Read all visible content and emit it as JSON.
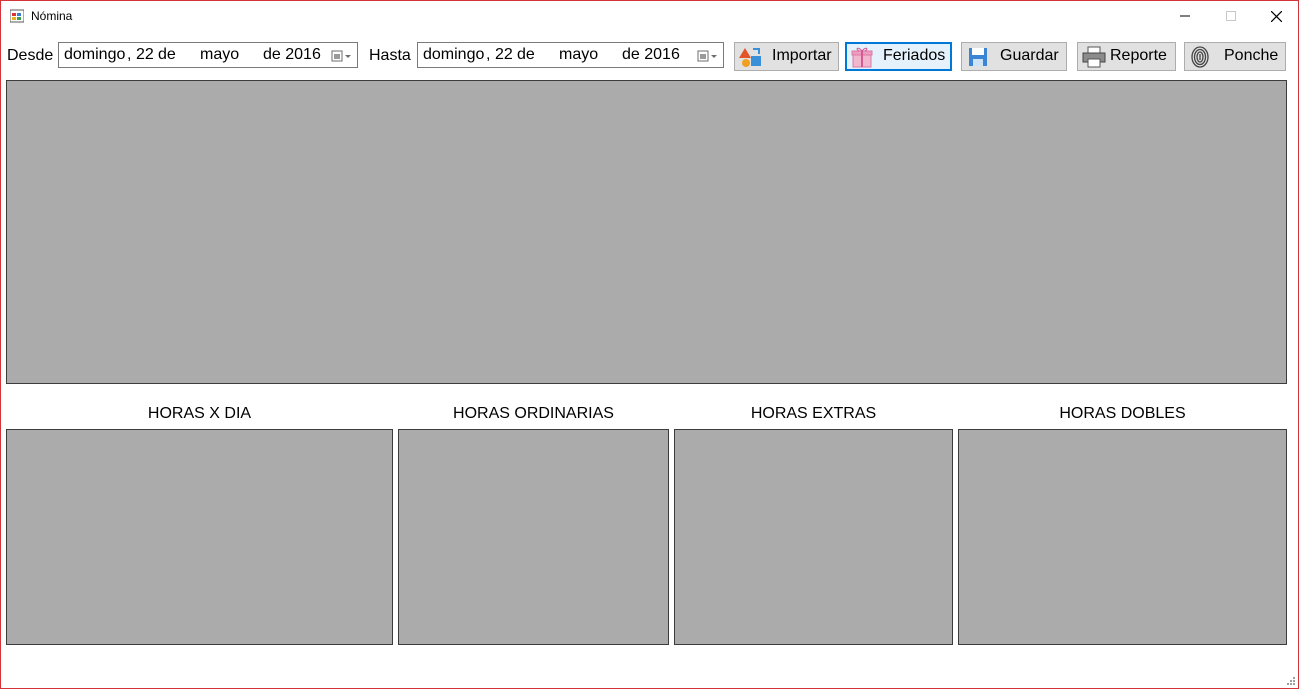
{
  "window": {
    "title": "Nómina"
  },
  "toolbar": {
    "desde_label": "Desde",
    "hasta_label": "Hasta",
    "desde_date": {
      "weekday": "domingo",
      "day": "22",
      "de1": "de",
      "month": "mayo",
      "year": "de 2016"
    },
    "hasta_date": {
      "weekday": "domingo",
      "day": "22",
      "de1": "de",
      "month": "mayo",
      "year": "de 2016"
    },
    "buttons": {
      "importar": "Importar",
      "feriados": "Feriados",
      "guardar": "Guardar",
      "reporte": "Reporte",
      "ponche": "Ponche"
    }
  },
  "panels": {
    "horas_x_dia": "HORAS X DIA",
    "horas_ordinarias": "HORAS ORDINARIAS",
    "horas_extras": "HORAS EXTRAS",
    "horas_dobles": "HORAS DOBLES"
  },
  "colors": {
    "panel_bg": "#ababab",
    "focus_accent": "#0078d7",
    "window_border": "#d2343a"
  }
}
